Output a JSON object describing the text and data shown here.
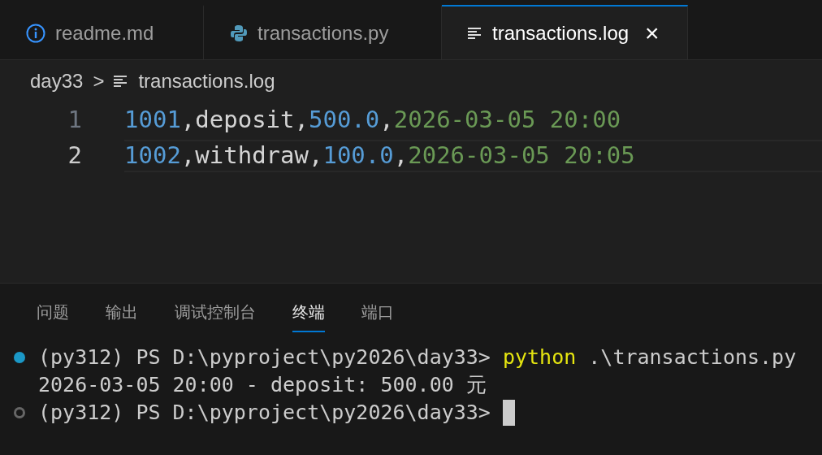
{
  "tabs": [
    {
      "label": "readme.md",
      "kind": "info",
      "selected": false
    },
    {
      "label": "transactions.py",
      "kind": "python",
      "selected": false
    },
    {
      "label": "transactions.log",
      "kind": "lines",
      "selected": true,
      "close": "×"
    }
  ],
  "breadcrumb": {
    "folder": "day33",
    "separator": ">",
    "file": "transactions.log"
  },
  "editor": {
    "lines": [
      {
        "number": "1",
        "current": false,
        "tokens": [
          {
            "text": "1001",
            "kind": "number"
          },
          {
            "text": ",deposit,",
            "kind": "text"
          },
          {
            "text": "500.0",
            "kind": "number"
          },
          {
            "text": ",",
            "kind": "text"
          },
          {
            "text": "2026-03-05 20:00",
            "kind": "date"
          }
        ]
      },
      {
        "number": "2",
        "current": true,
        "tokens": [
          {
            "text": "1002",
            "kind": "number"
          },
          {
            "text": ",withdraw,",
            "kind": "text"
          },
          {
            "text": "100.0",
            "kind": "number"
          },
          {
            "text": ",",
            "kind": "text"
          },
          {
            "text": "2026-03-05 20:05",
            "kind": "date"
          }
        ]
      }
    ]
  },
  "panel": {
    "tabs": [
      {
        "label": "问题",
        "selected": false
      },
      {
        "label": "输出",
        "selected": false
      },
      {
        "label": "调试控制台",
        "selected": false
      },
      {
        "label": "终端",
        "selected": true
      },
      {
        "label": "端口",
        "selected": false
      }
    ],
    "terminal": [
      {
        "kind": "success",
        "segments": [
          {
            "text": "(py312) PS D:\\pyproject\\py2026\\day33> ",
            "kind": "prompt"
          },
          {
            "text": "python",
            "kind": "command"
          },
          {
            "text": " .\\transactions.py",
            "kind": "prompt"
          }
        ]
      },
      {
        "kind": "output",
        "segments": [
          {
            "text": "2026-03-05 20:00 - deposit: 500.00 元",
            "kind": "prompt"
          }
        ]
      },
      {
        "kind": "pending",
        "cursor": true,
        "segments": [
          {
            "text": "(py312) PS D:\\pyproject\\py2026\\day33> ",
            "kind": "prompt"
          }
        ]
      }
    ]
  }
}
